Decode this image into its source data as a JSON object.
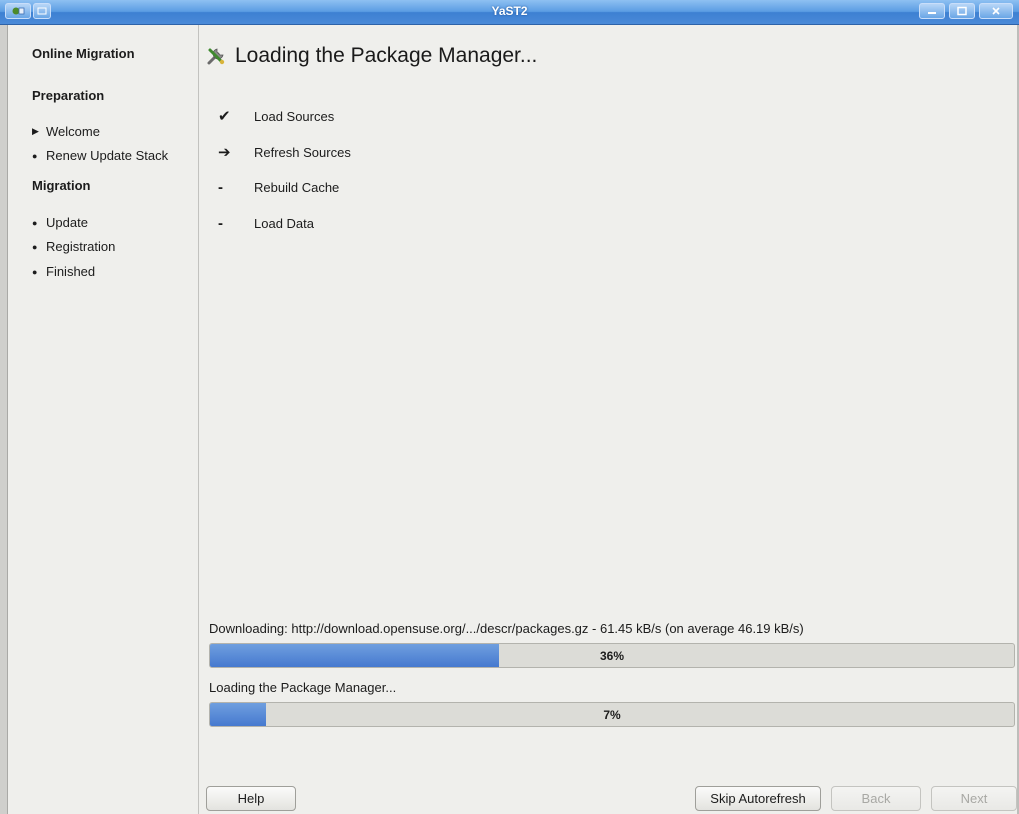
{
  "window": {
    "title": "YaST2"
  },
  "sidebar": {
    "title": "Online Migration",
    "sections": [
      {
        "label": "Preparation",
        "items": [
          {
            "label": "Welcome",
            "marker": "▶"
          },
          {
            "label": "Renew Update Stack",
            "marker": "●"
          }
        ]
      },
      {
        "label": "Migration",
        "items": [
          {
            "label": "Update",
            "marker": "●"
          },
          {
            "label": "Registration",
            "marker": "●"
          },
          {
            "label": "Finished",
            "marker": "●"
          }
        ]
      }
    ]
  },
  "main": {
    "heading": "Loading the Package Manager...",
    "heading_icon": "tools-icon",
    "steps": [
      {
        "mark": "✔",
        "label": "Load Sources",
        "state": "done"
      },
      {
        "mark": "➔",
        "label": "Refresh Sources",
        "state": "current"
      },
      {
        "mark": "-",
        "label": "Rebuild Cache",
        "state": "pending"
      },
      {
        "mark": "-",
        "label": "Load Data",
        "state": "pending"
      }
    ],
    "download": {
      "label": "Downloading: http://download.opensuse.org/.../descr/packages.gz - 61.45 kB/s (on average 46.19 kB/s)",
      "percent_text": "36%",
      "percent": 36
    },
    "loading": {
      "label": "Loading the Package Manager...",
      "percent_text": "7%",
      "percent": 7
    }
  },
  "buttons": {
    "help": "Help",
    "skip_autorefresh": "Skip Autorefresh",
    "back": "Back",
    "next": "Next"
  },
  "colors": {
    "titlebar": "#4a8ad8",
    "progress_fill": "#4679cf",
    "background": "#efefec"
  }
}
